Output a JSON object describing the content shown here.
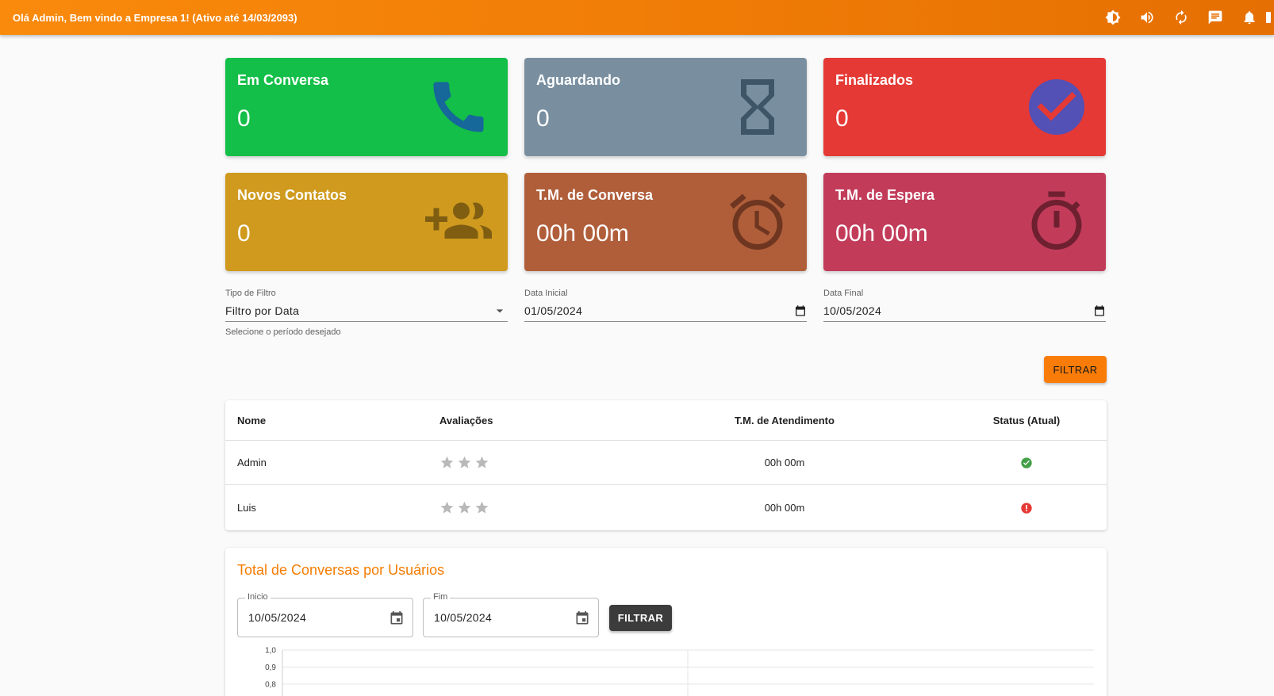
{
  "header": {
    "greeting": "Olá Admin, Bem vindo a Empresa 1! (Ativo até 14/03/2093)",
    "icons": [
      "theme-toggle-icon",
      "volume-icon",
      "refresh-icon",
      "chat-icon",
      "bell-icon"
    ]
  },
  "cards": [
    {
      "title": "Em Conversa",
      "value": "0",
      "color": "#13bf48",
      "icon": "phone-icon"
    },
    {
      "title": "Aguardando",
      "value": "0",
      "color": "#798fa0",
      "icon": "hourglass-icon"
    },
    {
      "title": "Finalizados",
      "value": "0",
      "color": "#e53935",
      "icon": "check-circle-icon"
    },
    {
      "title": "Novos Contatos",
      "value": "0",
      "color": "#cf9a1e",
      "icon": "group-add-icon"
    },
    {
      "title": "T.M. de Conversa",
      "value": "00h 00m",
      "color": "#b05e3a",
      "icon": "alarm-icon"
    },
    {
      "title": "T.M. de Espera",
      "value": "00h 00m",
      "color": "#c23c5a",
      "icon": "timer-icon"
    }
  ],
  "filters": {
    "type": {
      "label": "Tipo de Filtro",
      "value": "Filtro por Data",
      "help": "Selecione o período desejado"
    },
    "start": {
      "label": "Data Inicial",
      "value": "01/05/2024"
    },
    "end": {
      "label": "Data Final",
      "value": "10/05/2024"
    },
    "button": "FILTRAR"
  },
  "table": {
    "headers": [
      "Nome",
      "Avaliações",
      "T.M. de Atendimento",
      "Status (Atual)"
    ],
    "rows": [
      {
        "name": "Admin",
        "rating": 0,
        "max_rating": 3,
        "tm": "00h 00m",
        "status": "online",
        "status_color": "#43a047"
      },
      {
        "name": "Luis",
        "rating": 0,
        "max_rating": 3,
        "tm": "00h 00m",
        "status": "offline",
        "status_color": "#e53935"
      }
    ]
  },
  "chart_section": {
    "title": "Total de Conversas por Usuários",
    "start": {
      "label": "Inicio",
      "value": "10/05/2024"
    },
    "end": {
      "label": "Fim",
      "value": "10/05/2024"
    },
    "button": "FILTRAR"
  },
  "chart_data": {
    "type": "bar",
    "categories": [],
    "values": [],
    "title": "Total de Conversas por Usuários",
    "xlabel": "",
    "ylabel": "",
    "yticks": [
      "1,0",
      "0,9",
      "0,8"
    ],
    "ylim": [
      0,
      1
    ],
    "grid": true
  }
}
